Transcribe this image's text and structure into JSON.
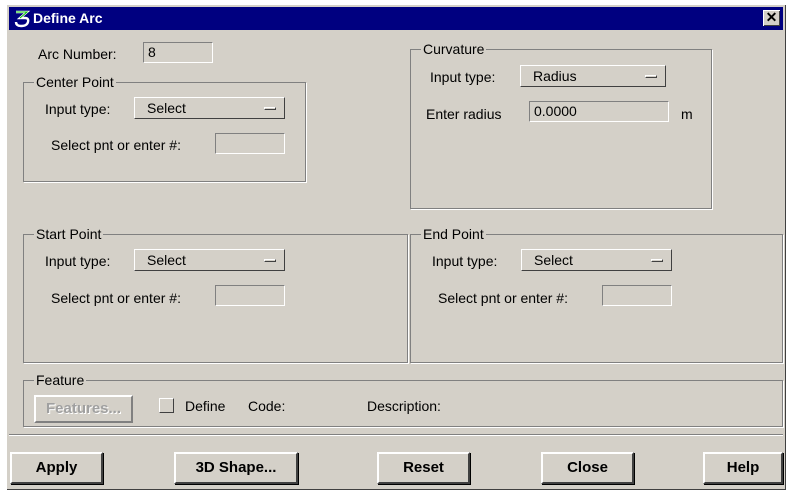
{
  "window": {
    "title": "Define Arc",
    "close_glyph": "✕"
  },
  "arc": {
    "label": "Arc Number:",
    "value": "8"
  },
  "curvature": {
    "caption": "Curvature",
    "input_type_label": "Input type:",
    "input_type_value": "Radius",
    "radius_label": "Enter radius",
    "radius_value": "0.0000",
    "unit": "m"
  },
  "center_point": {
    "caption": "Center Point",
    "input_type_label": "Input type:",
    "input_type_value": "Select",
    "select_label": "Select pnt or enter #:",
    "select_value": ""
  },
  "start_point": {
    "caption": "Start Point",
    "input_type_label": "Input type:",
    "input_type_value": "Select",
    "select_label": "Select pnt or enter #:",
    "select_value": ""
  },
  "end_point": {
    "caption": "End Point",
    "input_type_label": "Input type:",
    "input_type_value": "Select",
    "select_label": "Select pnt or enter #:",
    "select_value": ""
  },
  "feature": {
    "caption": "Feature",
    "features_button": "Features...",
    "define_label": "Define",
    "code_label": "Code:",
    "description_label": "Description:"
  },
  "buttons": {
    "apply": "Apply",
    "shape3d": "3D Shape...",
    "reset": "Reset",
    "close": "Close",
    "help": "Help"
  },
  "colors": {
    "titlebar": "#000080",
    "face": "#d4d0c8"
  }
}
